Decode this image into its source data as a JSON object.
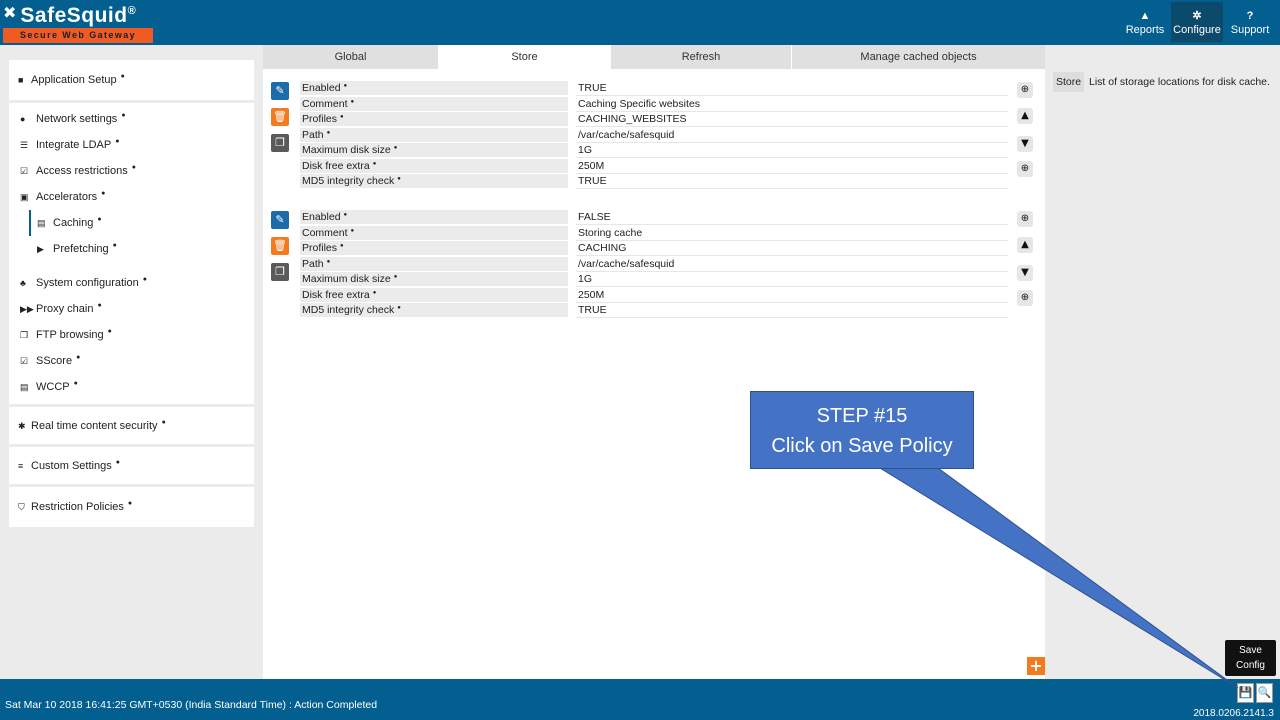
{
  "header": {
    "brand": "SafeSquid",
    "brand_reg": "®",
    "tagline": "Secure Web Gateway",
    "nav": [
      {
        "label": "Reports",
        "icon": "bar-chart-icon"
      },
      {
        "label": "Configure",
        "icon": "gears-icon"
      },
      {
        "label": "Support",
        "icon": "help-icon"
      }
    ]
  },
  "sidebar": {
    "application_setup": "Application Setup",
    "items": [
      {
        "label": "Network settings",
        "icon": "globe-icon"
      },
      {
        "label": "Integrate LDAP",
        "icon": "list-icon"
      },
      {
        "label": "Access restrictions",
        "icon": "checkbox-icon"
      },
      {
        "label": "Accelerators",
        "icon": "rocket-icon"
      },
      {
        "label": "Caching",
        "icon": "database-icon"
      },
      {
        "label": "Prefetching",
        "icon": "step-forward-icon"
      },
      {
        "label": "System configuration",
        "icon": "sitemap-icon"
      },
      {
        "label": "Proxy chain",
        "icon": "fast-forward-icon"
      },
      {
        "label": "FTP browsing",
        "icon": "files-icon"
      },
      {
        "label": "SScore",
        "icon": "checkbox-icon"
      },
      {
        "label": "WCCP",
        "icon": "server-icon"
      }
    ],
    "realtime": "Real time content security",
    "custom": "Custom Settings",
    "restriction": "Restriction Policies"
  },
  "tabs": [
    "Global",
    "Store",
    "Refresh",
    "Manage cached objects"
  ],
  "active_tab": "Store",
  "entries": [
    {
      "fields": [
        {
          "key": "Enabled",
          "value": "TRUE"
        },
        {
          "key": "Comment",
          "value": "Caching Specific websites"
        },
        {
          "key": "Profiles",
          "value": "CACHING_WEBSITES"
        },
        {
          "key": "Path",
          "value": "/var/cache/safesquid"
        },
        {
          "key": "Maximum disk size",
          "value": "1G"
        },
        {
          "key": "Disk free extra",
          "value": "250M"
        },
        {
          "key": "MD5 integrity check",
          "value": "TRUE"
        }
      ]
    },
    {
      "fields": [
        {
          "key": "Enabled",
          "value": "FALSE"
        },
        {
          "key": "Comment",
          "value": "Storing cache"
        },
        {
          "key": "Profiles",
          "value": "CACHING"
        },
        {
          "key": "Path",
          "value": "/var/cache/safesquid"
        },
        {
          "key": "Maximum disk size",
          "value": "1G"
        },
        {
          "key": "Disk free extra",
          "value": "250M"
        },
        {
          "key": "MD5 integrity check",
          "value": "TRUE"
        }
      ]
    }
  ],
  "right_panel": {
    "tag": "Store",
    "description": "List of storage locations for disk cache."
  },
  "footer": {
    "status": "Sat Mar 10 2018 16:41:25 GMT+0530 (India Standard Time) : Action Completed",
    "version": "2018.0206.2141.3",
    "tooltip_line1": "Save",
    "tooltip_line2": "Config"
  },
  "callout": {
    "line1": "STEP #15",
    "line2": "Click on Save Policy"
  },
  "colors": {
    "header_blue": "#035f8f",
    "brand_orange": "#f15a22",
    "callout_blue": "#4472c4"
  }
}
